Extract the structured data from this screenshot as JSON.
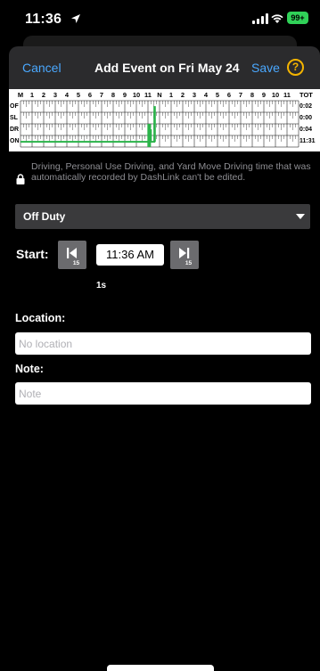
{
  "status_bar": {
    "time": "11:36",
    "battery": "99+"
  },
  "header": {
    "cancel_label": "Cancel",
    "title": "Add Event on Fri May 24",
    "save_label": "Save",
    "help_symbol": "?"
  },
  "log_grid": {
    "hours": [
      "M",
      "1",
      "2",
      "3",
      "4",
      "5",
      "6",
      "7",
      "8",
      "9",
      "10",
      "11",
      "N",
      "1",
      "2",
      "3",
      "4",
      "5",
      "6",
      "7",
      "8",
      "9",
      "10",
      "11"
    ],
    "rows": [
      {
        "label": "OF",
        "total": "0:02"
      },
      {
        "label": "SL",
        "total": "0:00"
      },
      {
        "label": "DR",
        "total": "0:04"
      },
      {
        "label": "ON",
        "total": "11:31"
      }
    ],
    "total_header": "TOT",
    "line_color": "#2bb34a"
  },
  "notice": {
    "text": "Driving, Personal Use Driving, and Yard Move Driving time that was automatically recorded by DashLink can't be edited."
  },
  "status_select": {
    "value": "Off Duty"
  },
  "start": {
    "label": "Start:",
    "back_step": "15",
    "time": "11:36 AM",
    "forward_step": "15",
    "duration": "1s"
  },
  "location": {
    "label": "Location:",
    "placeholder": "No location",
    "value": ""
  },
  "note": {
    "label": "Note:",
    "placeholder": "Note",
    "value": ""
  }
}
